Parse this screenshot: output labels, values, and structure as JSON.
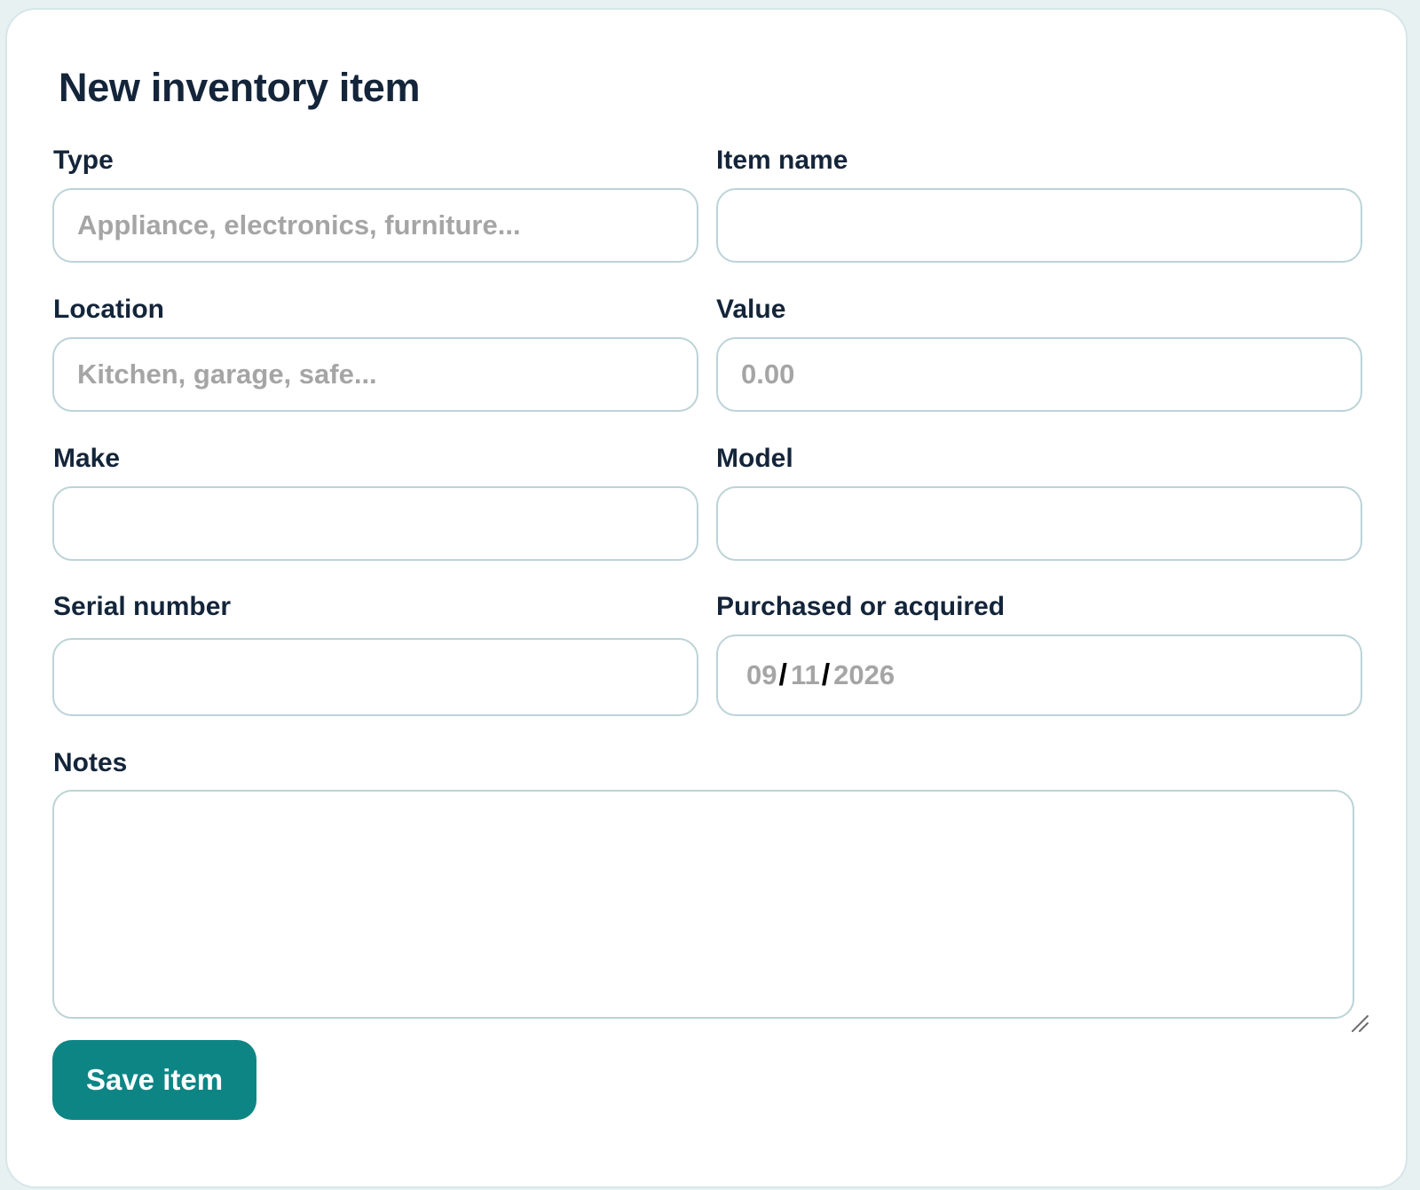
{
  "form": {
    "title": "New inventory item",
    "fields": {
      "type": {
        "label": "Type",
        "value": "",
        "placeholder": "Appliance, electronics, furniture..."
      },
      "item_name": {
        "label": "Item name",
        "value": "",
        "placeholder": ""
      },
      "location": {
        "label": "Location",
        "value": "",
        "placeholder": "Kitchen, garage, safe..."
      },
      "value": {
        "label": "Value",
        "value": "",
        "placeholder": "0.00"
      },
      "make": {
        "label": "Make",
        "value": "",
        "placeholder": ""
      },
      "model": {
        "label": "Model",
        "value": "",
        "placeholder": ""
      },
      "serial_number": {
        "label": "Serial number",
        "value": "",
        "placeholder": ""
      },
      "purchased": {
        "label": "Purchased or acquired",
        "month": "09",
        "day": "11",
        "year": "2026",
        "separator": "/"
      },
      "notes": {
        "label": "Notes",
        "value": "",
        "placeholder": ""
      }
    },
    "save_label": "Save item"
  },
  "colors": {
    "accent": "#0e8585",
    "text": "#14253a",
    "placeholder": "#a5a5a5",
    "border": "#bcd3d7",
    "page_background": "#e8f1f2"
  }
}
